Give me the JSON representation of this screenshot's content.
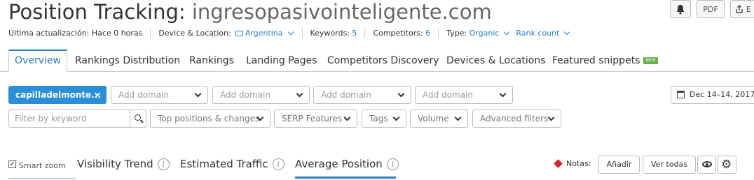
{
  "header": {
    "title_prefix": "Position Tracking:",
    "title_domain": "ingresopasivointeligente.com",
    "pdf_label": "PDF",
    "export_label": "E"
  },
  "meta": {
    "last_update": "Última actualización: Hace 0 horas",
    "device_label": "Device & Location:",
    "device_value": "Argentina",
    "keywords_label": "Keywords:",
    "keywords_value": "5",
    "competitors_label": "Competitors:",
    "competitors_value": "6",
    "type_label": "Type:",
    "type_value": "Organic",
    "rank_count": "Rank count"
  },
  "tabs": [
    {
      "label": "Overview",
      "active": true
    },
    {
      "label": "Rankings Distribution"
    },
    {
      "label": "Rankings"
    },
    {
      "label": "Landing Pages"
    },
    {
      "label": "Competitors Discovery"
    },
    {
      "label": "Devices & Locations"
    },
    {
      "label": "Featured snippets",
      "badge": "NEW"
    }
  ],
  "domains": {
    "main": "capilladelmonte...",
    "add_placeholder": "Add domain"
  },
  "date_range": "Dec 14–14, 2017",
  "filters": {
    "keyword_placeholder": "Filter by keyword",
    "top_positions": "Top positions & changes",
    "serp_features": "SERP Features",
    "tags": "Tags",
    "volume": "Volume",
    "advanced": "Advanced filters"
  },
  "chart_tabs": {
    "smart_zoom": "Smart zoom",
    "visibility": "Visibility Trend",
    "traffic": "Estimated Traffic",
    "avg_position": "Average Position",
    "info_glyph": "i"
  },
  "notes": {
    "label": "Notas:",
    "add": "Añadir",
    "view_all": "Ver todas"
  },
  "colors": {
    "accent": "#2b7fc4",
    "primary_button": "#2b8fd8",
    "new_badge": "#6ab04c",
    "notes_marker": "#d9232d"
  }
}
